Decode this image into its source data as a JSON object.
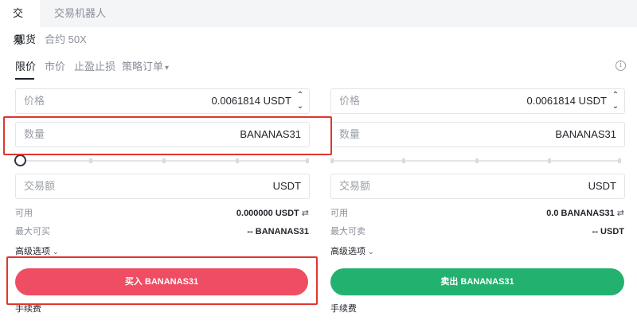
{
  "tabs": {
    "trade": "交易",
    "robot": "交易机器人"
  },
  "account_types": {
    "spot": "现货",
    "futures": "合约 50X"
  },
  "order_types": [
    {
      "label": "限价",
      "active": true
    },
    {
      "label": "市价",
      "active": false
    },
    {
      "label": "止盈止损",
      "active": false
    },
    {
      "label": "策略订单",
      "active": false
    }
  ],
  "order_type_dropdown_icon": "▾",
  "info_icon": "i",
  "buy": {
    "price": {
      "label": "价格",
      "value": "0.0061814 USDT"
    },
    "quantity": {
      "label": "数量",
      "value": "BANANAS31"
    },
    "amount": {
      "label": "交易额",
      "value": "USDT"
    },
    "available": {
      "label": "可用",
      "value": "0.000000 USDT"
    },
    "max": {
      "label": "最大可买",
      "value": "-- BANANAS31"
    },
    "advanced": "高级选项",
    "button": "买入 BANANAS31",
    "fee": "手续费"
  },
  "sell": {
    "price": {
      "label": "价格",
      "value": "0.0061814 USDT"
    },
    "quantity": {
      "label": "数量",
      "value": "BANANAS31"
    },
    "amount": {
      "label": "交易额",
      "value": "USDT"
    },
    "available": {
      "label": "可用",
      "value": "0.0 BANANAS31"
    },
    "max": {
      "label": "最大可卖",
      "value": "-- USDT"
    },
    "advanced": "高级选项",
    "button": "卖出 BANANAS31",
    "fee": "手续费"
  },
  "icons": {
    "stepper_up": "⌃",
    "stepper_down": "⌄",
    "swap": "⇄",
    "chevron": "⌄"
  },
  "colors": {
    "buy": "#ef4d63",
    "sell": "#23b16f",
    "highlight": "#e0362f"
  }
}
